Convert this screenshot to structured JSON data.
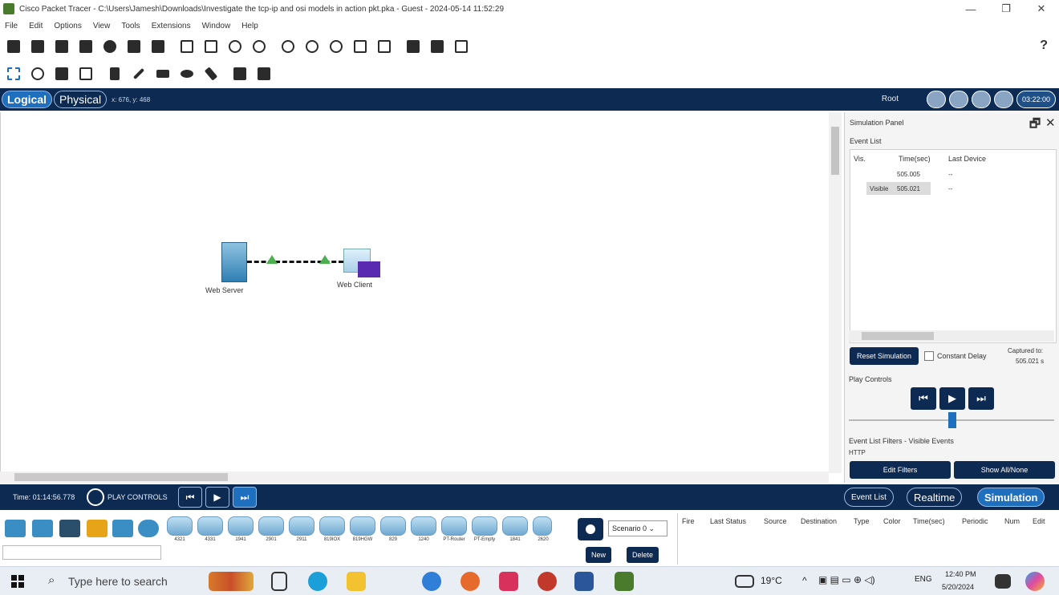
{
  "window": {
    "title": "Cisco Packet Tracer - C:\\Users\\Jamesh\\Downloads\\Investigate the tcp-ip and osi models in action pkt.pka - Guest - 2024-05-14 11:52:29",
    "minimize": "—",
    "maximize": "❐",
    "close": "✕"
  },
  "menu": [
    "File",
    "Edit",
    "Options",
    "View",
    "Tools",
    "Extensions",
    "Window",
    "Help"
  ],
  "toolbar": {
    "help": "?",
    "row1_icons": [
      "new-icon",
      "open-icon",
      "save-icon",
      "print-icon",
      "activity-wizard-icon",
      "network-info-icon",
      "ip-icon",
      "copy-icon",
      "paste-icon",
      "undo-icon",
      "redo-icon",
      "zoom-in-icon",
      "zoom-reset-icon",
      "zoom-out-icon",
      "drawing-palette-icon",
      "custom-device-icon",
      "viewport-icon",
      "user-profile-icon",
      "image-icon"
    ],
    "row2_icons": [
      "select-icon",
      "inspect-icon",
      "delete-icon",
      "resize-icon",
      "note-icon",
      "line-icon",
      "rectangle-icon",
      "ellipse-icon",
      "freeform-icon",
      "simple-pdu-icon",
      "complex-pdu-icon"
    ]
  },
  "topbar": {
    "logical": "Logical",
    "physical": "Physical",
    "coords": "x: 676, y: 468",
    "root": "Root",
    "clock": "03:22:00"
  },
  "workspace": {
    "server_label": "Web Server",
    "client_label": "Web Client"
  },
  "sim_panel": {
    "title": "Simulation Panel",
    "restore": "🗗",
    "close": "✕",
    "event_list_label": "Event List",
    "col_vis": "Vis.",
    "col_time": "Time(sec)",
    "col_last_device": "Last Device",
    "rows": [
      {
        "vis": "",
        "time": "505.005",
        "last": "--"
      },
      {
        "vis": "Visible",
        "time": "505.021",
        "last": "--"
      }
    ],
    "reset": "Reset Simulation",
    "constant_delay": "Constant Delay",
    "captured_to": "Captured to:",
    "captured_value": "505.021 s",
    "play_controls": "Play Controls",
    "filters_label": "Event List Filters - Visible Events",
    "filter_value": "HTTP",
    "edit_filters": "Edit Filters",
    "show_all": "Show All/None"
  },
  "bottombar": {
    "time": "Time: 01:14:56.778",
    "play_controls": "PLAY CONTROLS",
    "back": "⏮",
    "play": "▶",
    "forward": "⏭",
    "event_list": "Event List",
    "realtime": "Realtime",
    "simulation": "Simulation"
  },
  "palette": {
    "devices": [
      "4321",
      "4331",
      "1941",
      "2901",
      "2911",
      "819IOX",
      "819HGW",
      "829",
      "1240",
      "PT-Router",
      "PT-Empty",
      "1841",
      "2620"
    ],
    "scenario": "Scenario 0",
    "new": "New",
    "delete": "Delete",
    "pdu_columns": [
      "Fire",
      "Last Status",
      "Source",
      "Destination",
      "Type",
      "Color",
      "Time(sec)",
      "Periodic",
      "Num",
      "Edit"
    ]
  },
  "taskbar": {
    "search_placeholder": "Type here to search",
    "temp": "19°C",
    "lang": "ENG",
    "time": "12:40 PM",
    "date": "5/20/2024"
  },
  "colors": {
    "navy": "#0d2a52",
    "accent": "#1f6fbf",
    "link": "#4caf50",
    "envelope": "#5a2bb0"
  }
}
